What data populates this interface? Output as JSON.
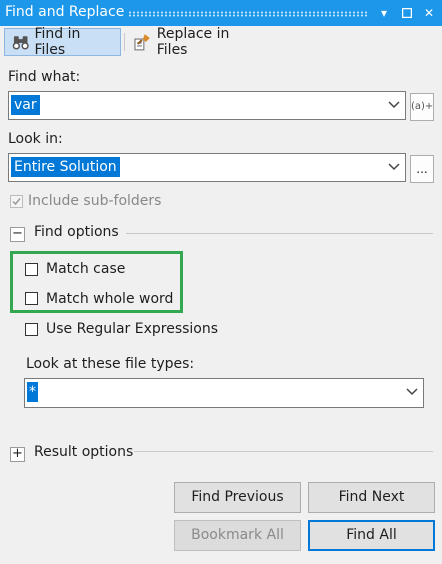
{
  "window": {
    "title": "Find and Replace",
    "controls": {
      "dropdown": "▾",
      "pin": "☐",
      "close": "✕"
    }
  },
  "tabs": [
    {
      "label": "Find in Files",
      "icon": "binoculars-icon",
      "active": true
    },
    {
      "label": "Replace in Files",
      "icon": "replace-icon",
      "active": false
    }
  ],
  "find_what": {
    "label": "Find what:",
    "value": "var",
    "side_button": "(a)+"
  },
  "look_in": {
    "label": "Look in:",
    "value": "Entire Solution",
    "side_button": "..."
  },
  "include_subfolders": {
    "label": "Include sub-folders",
    "checked": true,
    "disabled": true
  },
  "find_options": {
    "label": "Find options",
    "expander": "−",
    "match_case": {
      "label": "Match case",
      "checked": false
    },
    "match_whole_word": {
      "label": "Match whole word",
      "checked": false
    },
    "use_regex": {
      "label": "Use Regular Expressions",
      "checked": false
    },
    "file_types": {
      "label": "Look at these file types:",
      "value": "*"
    }
  },
  "result_options": {
    "label": "Result options",
    "expander": "+"
  },
  "buttons": {
    "find_previous": "Find Previous",
    "find_next": "Find Next",
    "bookmark_all": "Bookmark All",
    "find_all": "Find All"
  },
  "colors": {
    "title_bar": "#1c97ea",
    "selection": "#0078d7",
    "highlight_box": "#33a851"
  }
}
